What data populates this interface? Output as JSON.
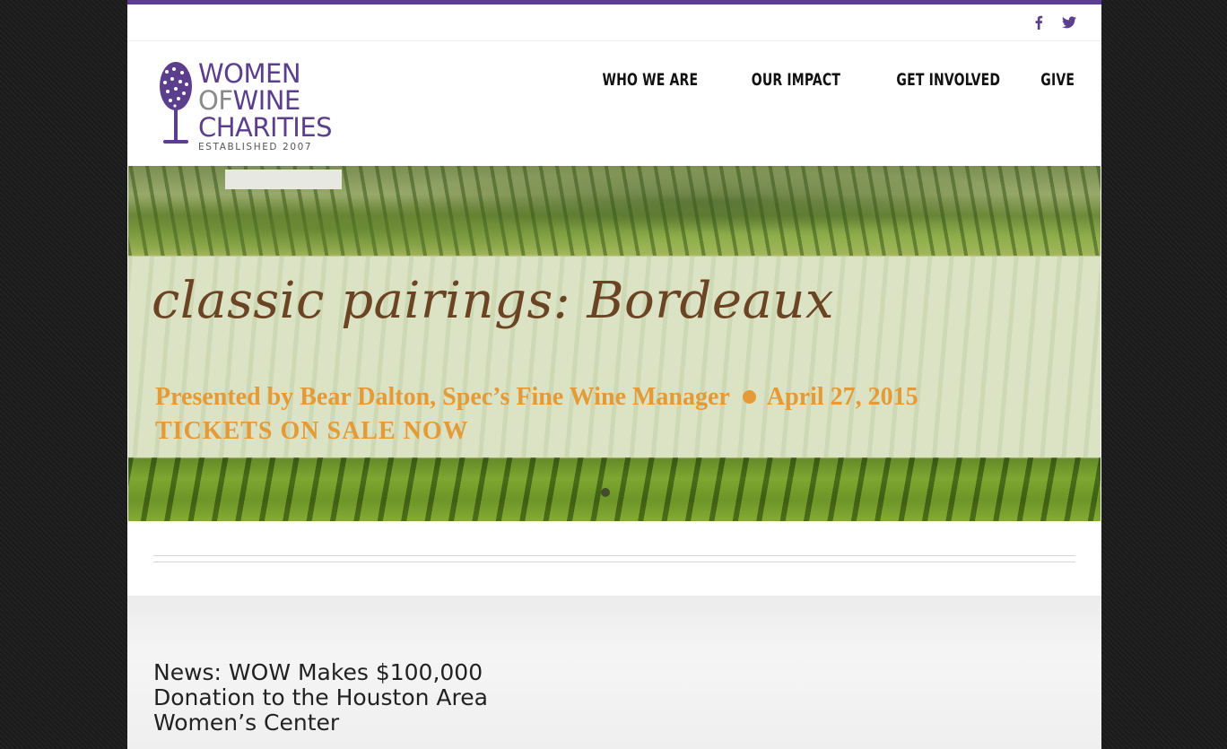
{
  "social": {
    "facebook_icon": "facebook-icon",
    "twitter_icon": "twitter-icon"
  },
  "logo": {
    "line1": "WOMEN",
    "line2_a": "OF",
    "line2_b": "WINE",
    "line3": "CHARITIES",
    "established": "ESTABLISHED 2007"
  },
  "nav": {
    "items": [
      {
        "label": "WHO WE ARE"
      },
      {
        "label": "OUR IMPACT"
      },
      {
        "label": "GET INVOLVED"
      },
      {
        "label": "GIVE"
      }
    ]
  },
  "hero": {
    "title": "classic pairings: Bordeaux",
    "presented": "Presented by Bear Dalton, Spec’s Fine Wine Manager",
    "date": "April 27, 2015",
    "tickets": "TICKETS ON SALE NOW"
  },
  "news": {
    "title": "News: WOW Makes $100,000 Donation to the Houston Area Women’s Center"
  },
  "colors": {
    "brand_purple": "#5b3f8c",
    "hero_orange": "#e49a36",
    "hero_brown": "#6b4424"
  }
}
